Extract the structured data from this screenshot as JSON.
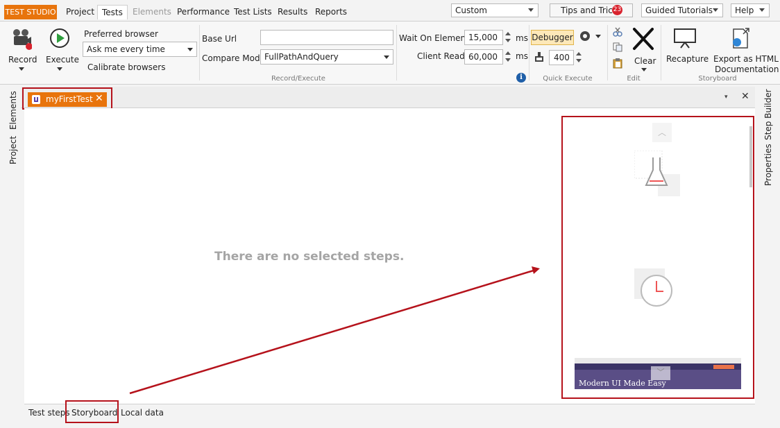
{
  "app": {
    "brand": "TEST STUDIO",
    "menu": [
      "Project",
      "Tests",
      "Elements",
      "Performance",
      "Test Lists",
      "Results",
      "Reports"
    ],
    "layout_select": "Custom",
    "tips": "Tips and Tricks",
    "tips_count": "23",
    "guided": "Guided Tutorials",
    "help": "Help"
  },
  "ribbon": {
    "record": "Record",
    "execute": "Execute",
    "preferred_browser_label": "Preferred browser",
    "preferred_browser_value": "Ask me every time",
    "calibrate": "Calibrate browsers",
    "base_url_label": "Base Url",
    "base_url_value": "",
    "compare_mode_label": "Compare Mode",
    "compare_mode_value": "FullPathAndQuery",
    "wait_label": "Wait On Elements",
    "wait_value": "15,000",
    "client_ready_label": "Client Ready",
    "client_ready_value": "60,000",
    "ms": "ms",
    "debugger": "Debugger",
    "quick_value": "400",
    "clear": "Clear",
    "recapture": "Recapture",
    "export": "Export as HTML",
    "export2": "Documentation",
    "groups": {
      "record_execute": "Record/Execute",
      "quick_execute": "Quick Execute",
      "edit": "Edit",
      "storyboard": "Storyboard"
    }
  },
  "left_rail": [
    "Elements",
    "Project"
  ],
  "right_rail": [
    "Step Builder",
    "Properties"
  ],
  "doc_tab": "myFirstTest",
  "empty_message": "There are no selected steps.",
  "bottom_tabs": [
    "Test steps",
    "Storyboard",
    "Local data"
  ],
  "storyboard_thumb": "Modern UI Made Easy",
  "colors": {
    "accent": "#e8740c",
    "highlight": "#b5121b"
  }
}
